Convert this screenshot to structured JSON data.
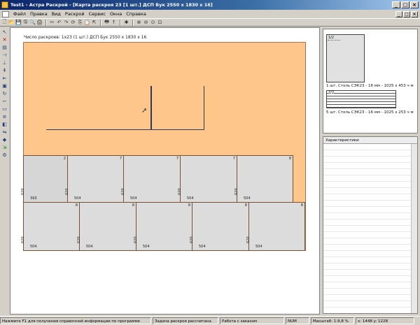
{
  "window": {
    "title": "Test1 - Астра Раскрой - [Карта раскроя 23 [1 шт.] ДСП Бук 2550 x 1830 x 16]",
    "buttons": {
      "minimize": "_",
      "maximize": "□",
      "close": "×"
    }
  },
  "menu": {
    "items": [
      "Файл",
      "Правка",
      "Вид",
      "Раскрой",
      "Сервис",
      "Окна",
      "Справка"
    ]
  },
  "toolbar": {
    "icons": [
      "new-icon",
      "open-icon",
      "save-icon",
      "save-all-icon",
      "print-preview-icon",
      "print-icon",
      "cut-icon",
      "undo-icon",
      "redo-icon",
      "refresh-icon",
      "copy-icon",
      "paste-icon",
      "export-icon",
      "printer-icon",
      "arrow-up-icon",
      "magic-icon",
      "zoom-in-icon",
      "zoom-out-icon",
      "zoom-fit-icon",
      "zoom-page-icon"
    ],
    "glyphs": [
      "🗋",
      "📂",
      "💾",
      "🖫",
      "🔍",
      "🖨",
      "✂",
      "↶",
      "↷",
      "⟳",
      "⎘",
      "📋",
      "⇱",
      "🖶",
      "↑",
      "✱",
      "⊕",
      "⊖",
      "⊙",
      "⊡"
    ]
  },
  "left_tools": {
    "icons": [
      "select-arrow-icon",
      "delete-icon",
      "layer-icon",
      "cut-horizontal-icon",
      "cut-vertical-icon",
      "align-top-icon",
      "align-left-icon",
      "group-icon",
      "rotate-icon",
      "trim-icon",
      "edge-icon",
      "stack-icon",
      "fill-icon",
      "flip-icon",
      "paint-icon",
      "export-icon",
      "settings-icon"
    ],
    "glyphs": [
      "↖",
      "✕",
      "▤",
      "⊣",
      "⊥",
      "⇞",
      "⇤",
      "▣",
      "↻",
      "⌐",
      "▭",
      "≡",
      "◧",
      "⇋",
      "◆",
      "⇲",
      "⚙"
    ]
  },
  "sheet": {
    "header": "Число раскроев: 1x23 (1 шт.) ДСП Бук 2550 x 1830 x 16"
  },
  "parts": {
    "row1": [
      {
        "qty": "2",
        "width": "393",
        "height": "620"
      },
      {
        "qty": "7",
        "width": "504",
        "height": "620"
      },
      {
        "qty": "7",
        "width": "504",
        "height": "620"
      },
      {
        "qty": "7",
        "width": "504",
        "height": "620"
      },
      {
        "qty": "8",
        "width": "504",
        "height": "620"
      }
    ],
    "row2": [
      {
        "qty": "8",
        "width": "504",
        "height": "620"
      },
      {
        "qty": "8",
        "width": "504",
        "height": "620"
      },
      {
        "qty": "8",
        "width": "504",
        "height": "620"
      },
      {
        "qty": "8",
        "width": "504",
        "height": "620"
      },
      {
        "qty": "8",
        "width": "504",
        "height": "620"
      }
    ]
  },
  "right_panel": {
    "thumb1_index": "1/2",
    "thumb1_caption": "1 шт. Столь СЭК23 - 16 мм - 1025 х 453 ч м",
    "thumb2_index": "2/2",
    "thumb2_caption": "5 шт. Столь СЭК23 - 16 мм - 1025 х 253 ч м",
    "props_header": "Характеристики"
  },
  "status": {
    "hint": "Нажмите F1 для получения справочной информации по программе",
    "mode": "Задача раскроя рассчитана",
    "state": "Работа с заказом",
    "caps": "NUM",
    "scale": "Масштаб: 1:9,8 %",
    "coords": "x: 1448 y: 1228"
  }
}
